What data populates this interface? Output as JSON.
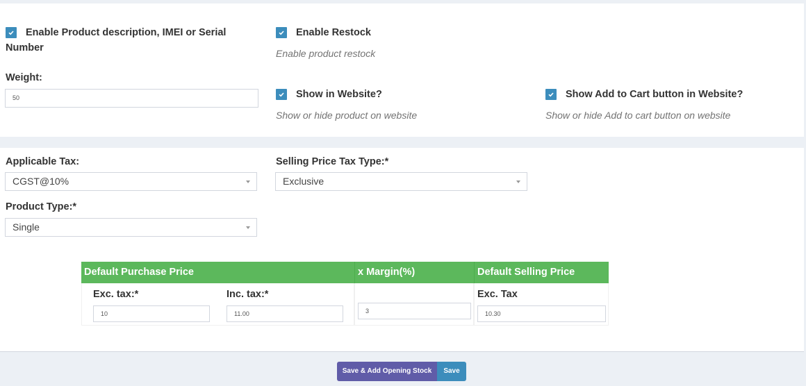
{
  "section1": {
    "enable_description": {
      "label_line1": "Enable Product description, IMEI or Serial",
      "label_line2": "Number",
      "checked": true
    },
    "enable_restock": {
      "label": "Enable Restock",
      "help": "Enable product restock",
      "checked": true
    },
    "weight": {
      "label": "Weight:",
      "value": "50"
    },
    "show_in_website": {
      "label": "Show in Website?",
      "help": "Show or hide product on website",
      "checked": true
    },
    "show_add_to_cart": {
      "label": "Show Add to Cart button in Website?",
      "help": "Show or hide Add to cart button on website",
      "checked": true
    }
  },
  "section2": {
    "applicable_tax": {
      "label": "Applicable Tax:",
      "value": "CGST@10%"
    },
    "selling_price_tax_type": {
      "label": "Selling Price Tax Type:*",
      "value": "Exclusive"
    },
    "product_type": {
      "label": "Product Type:*",
      "value": "Single"
    },
    "price_table": {
      "headers": {
        "purchase": "Default Purchase Price",
        "margin": "x Margin(%)",
        "selling": "Default Selling Price"
      },
      "exc_tax_label": "Exc. tax:*",
      "exc_tax_value": "10",
      "inc_tax_label": "Inc. tax:*",
      "inc_tax_value": "11.00",
      "margin_value": "3",
      "selling_exc_label": "Exc. Tax",
      "selling_exc_value": "10.30"
    }
  },
  "footer": {
    "save_add_stock": "Save & Add Opening Stock",
    "save": "Save"
  },
  "colors": {
    "checkbox": "#3c8dbc",
    "table_header": "#5cb85c",
    "btn_purple": "#605ca8",
    "btn_blue": "#3c8dbc"
  }
}
